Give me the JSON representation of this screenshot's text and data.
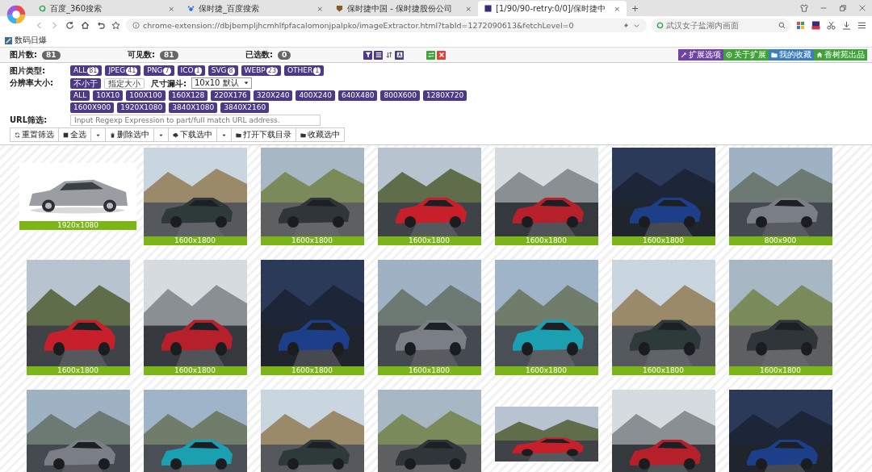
{
  "browser": {
    "tabs": [
      {
        "title": "百度_360搜索",
        "selected": false,
        "close": "×"
      },
      {
        "title": "保时捷_百度搜索",
        "selected": false,
        "close": "×"
      },
      {
        "title": "保时捷中国 - 保时捷股份公司",
        "selected": false,
        "close": "×"
      },
      {
        "title": "[1/90/90-retry:0/0]/保时捷中",
        "selected": true,
        "close": "×"
      }
    ],
    "new_tab": "+",
    "address": "chrome-extension://dbjbempljhcmhlfpfacalomonjpalpko/imageExtractor.html?tabId=1272090613&fetchLevel=0",
    "search_placeholder": "武汉女子盐湖内画面",
    "bookmarks": [
      "数码日爆"
    ]
  },
  "stats": [
    {
      "label": "图片数:",
      "count": "81"
    },
    {
      "label": "可见数:",
      "count": "81"
    },
    {
      "label": "已选数:",
      "count": "0"
    }
  ],
  "links": [
    {
      "label": "扩展选项",
      "color": "#6f42a6"
    },
    {
      "label": "关于扩展",
      "color": "#3fa33a"
    },
    {
      "label": "我的收藏",
      "color": "#3a7dc0"
    },
    {
      "label": "香树苑出品",
      "color": "#3fa33a"
    }
  ],
  "filters": {
    "type_label": "图片类型:",
    "types": [
      {
        "name": "ALL",
        "count": "81"
      },
      {
        "name": "JPEG",
        "count": "41"
      },
      {
        "name": "PNG",
        "count": "7"
      },
      {
        "name": "ICO",
        "count": "1"
      },
      {
        "name": "SVG",
        "count": "8"
      },
      {
        "name": "WEBP",
        "count": "23"
      },
      {
        "name": "OTHER",
        "count": "1"
      }
    ],
    "size_label": "分辨率大小:",
    "size_modes": [
      {
        "label": "不小于",
        "selected": true
      },
      {
        "label": "指定大小",
        "selected": false
      }
    ],
    "funnel_label": "尺寸漏斗:",
    "funnel_value": "10x10 默认",
    "resolutions": [
      "ALL",
      "10X10",
      "100X100",
      "160X128",
      "220X176",
      "320X240",
      "400X240",
      "640X480",
      "800X600",
      "1280X720",
      "1600X900",
      "1920X1080",
      "3840X1080",
      "3840X2160"
    ],
    "url_label": "URL筛选:",
    "url_placeholder": "Input Regexp Expression to part/full match URL address."
  },
  "actions": [
    {
      "kind": "button",
      "label": "重置筛选"
    },
    {
      "kind": "button",
      "label": "全选"
    },
    {
      "kind": "caret"
    },
    {
      "kind": "button",
      "label": "删除选中"
    },
    {
      "kind": "caret"
    },
    {
      "kind": "button",
      "label": "下载选中"
    },
    {
      "kind": "caret"
    },
    {
      "kind": "button",
      "label": "打开下载目录"
    },
    {
      "kind": "button",
      "label": "收藏选中"
    }
  ],
  "rows": [
    [
      {
        "kind": "picture",
        "size": "1920x1080"
      },
      {
        "kind": "picture",
        "size": "1600x1800"
      },
      {
        "kind": "picture",
        "size": "1600x1800"
      },
      {
        "kind": "picture",
        "size": "1600x1800"
      },
      {
        "kind": "picture",
        "size": "1600x1800"
      },
      {
        "kind": "picture",
        "size": "1600x1800"
      },
      {
        "kind": "picture",
        "size": "800x900"
      }
    ],
    [
      {
        "kind": "picture",
        "size": "1600x1800"
      },
      {
        "kind": "picture",
        "size": "1600x1800"
      },
      {
        "kind": "picture",
        "size": "1600x1800"
      },
      {
        "kind": "picture",
        "size": "1600x1800"
      },
      {
        "kind": "picture",
        "size": "1600x1800"
      },
      {
        "kind": "picture",
        "size": "1600x1800"
      },
      {
        "kind": "picture",
        "size": "1600x1800"
      }
    ],
    [
      {
        "kind": "picture"
      },
      {
        "kind": "picture"
      },
      {
        "kind": "picture"
      },
      {
        "kind": "picture"
      },
      {
        "kind": "picture"
      },
      {
        "kind": "picture"
      },
      {
        "kind": "picture"
      }
    ]
  ]
}
